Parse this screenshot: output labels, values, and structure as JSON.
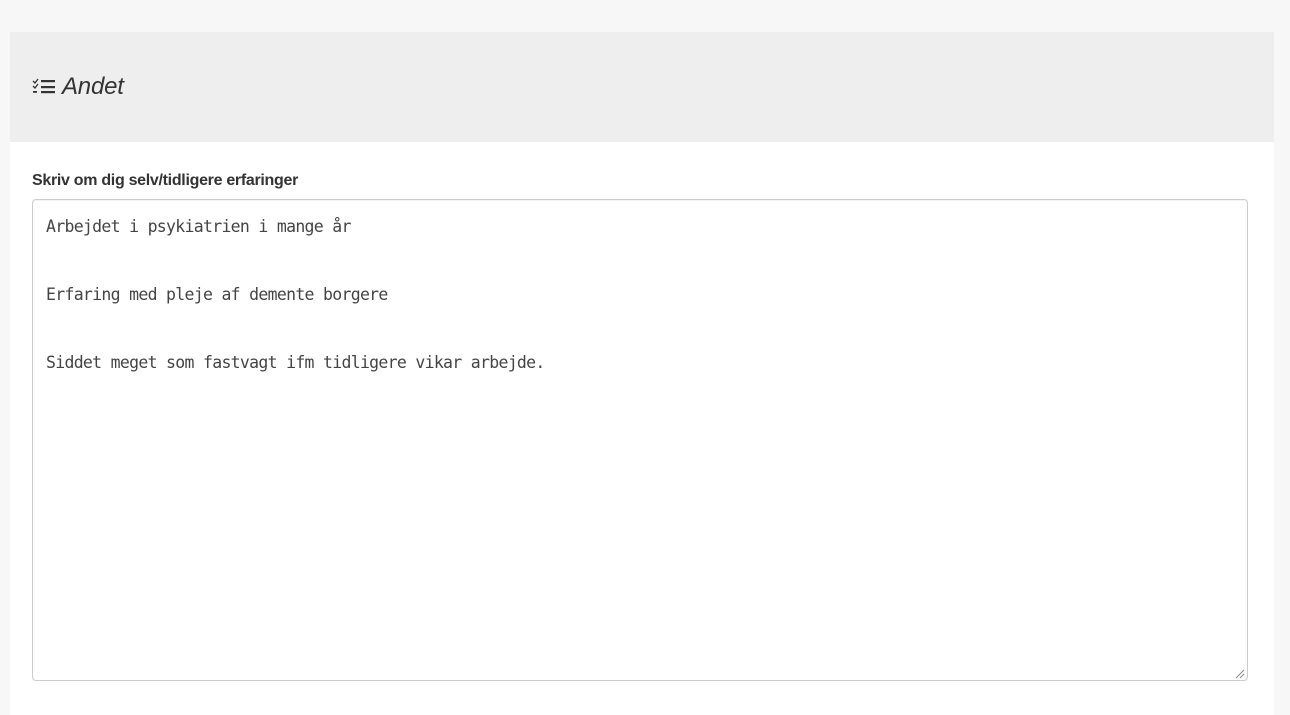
{
  "section": {
    "icon": "tasks-list-icon",
    "title": "Andet"
  },
  "field": {
    "label": "Skriv om dig selv/tidligere erfaringer",
    "value": "Arbejdet i psykiatrien i mange år\n\nErfaring med pleje af demente borgere\n\nSiddet meget som fastvagt ifm tidligere vikar arbejde."
  },
  "colors": {
    "header_background": "#eeeeee",
    "page_background": "#f7f7f7",
    "text": "#333333"
  }
}
